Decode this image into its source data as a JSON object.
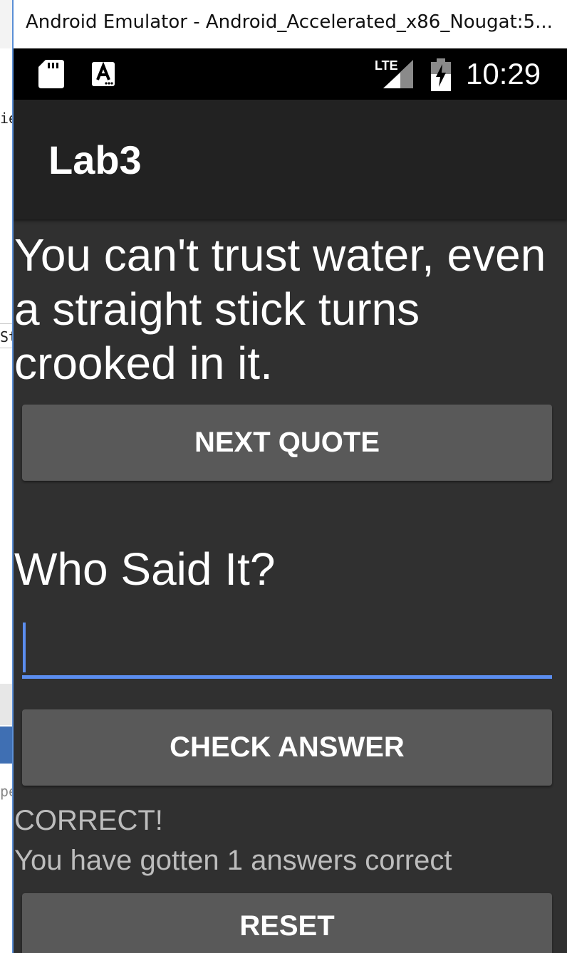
{
  "window": {
    "title": "Android Emulator - Android_Accelerated_x86_Nougat:5..."
  },
  "status_bar": {
    "time": "10:29",
    "network_label": "LTE",
    "icons": [
      "sd-card-icon",
      "keyboard-a-icon",
      "lte-signal-icon",
      "battery-charging-icon"
    ]
  },
  "action_bar": {
    "title": "Lab3"
  },
  "main": {
    "quote": "You can't trust water, even a straight stick turns crooked in it.",
    "next_button": "NEXT QUOTE",
    "prompt": "Who Said It?",
    "answer_input": {
      "value": "",
      "placeholder": ""
    },
    "check_button": "CHECK ANSWER",
    "result": "CORRECT!",
    "score": "You have gotten 1 answers correct",
    "reset_button": "RESET"
  },
  "background_fragments": {
    "line_1": "ie",
    "line_2": "St",
    "line_3": "pe"
  },
  "colors": {
    "app_background": "#303030",
    "action_bar": "#222222",
    "button": "#595959",
    "accent": "#5b8def",
    "status_bar": "#000000"
  }
}
